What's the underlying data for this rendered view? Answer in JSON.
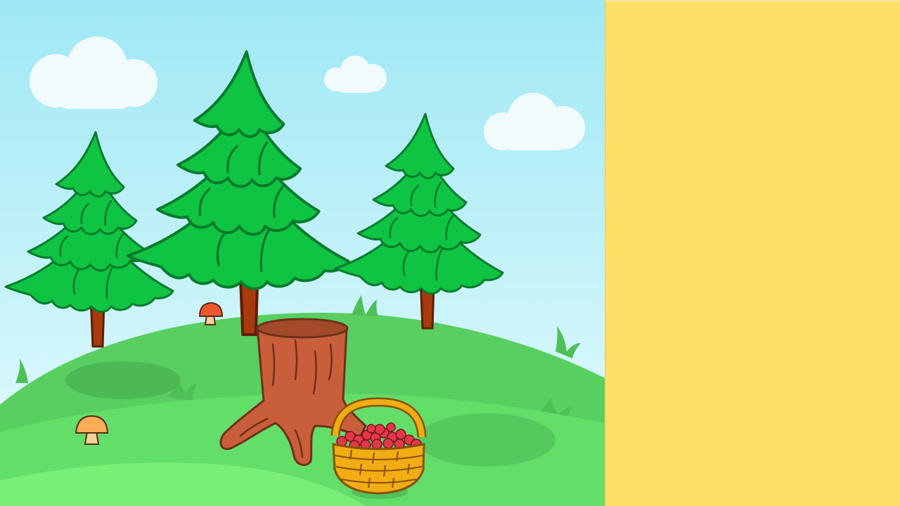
{
  "scene": {
    "name": "forest-clearing",
    "colors": {
      "sky_top": "#9fe8f5",
      "sky_bottom": "#e6fbfd",
      "cloud": "#f1fbfc",
      "hill_far": "#58cf60",
      "hill_mid": "#63de69",
      "hill_near": "#79ef76",
      "tree_green": "#0fc442",
      "tree_outline": "#077a2c",
      "trunk": "#a83a0e",
      "stump": "#c95f3a",
      "stump_outline": "#6e2f1a",
      "basket": "#f1ad13",
      "basket_outline": "#8a4f05",
      "berry": "#e43849",
      "mushroom_cap_red": "#ec5a2d",
      "mushroom_cap_orange": "#f9ad57",
      "mushroom_stem": "#f6d29a"
    },
    "objects": {
      "trees": 3,
      "clouds": 3,
      "mushrooms": 2,
      "stump": 1,
      "basket": 1
    }
  },
  "side_panel": {
    "background": "#ffe066"
  }
}
